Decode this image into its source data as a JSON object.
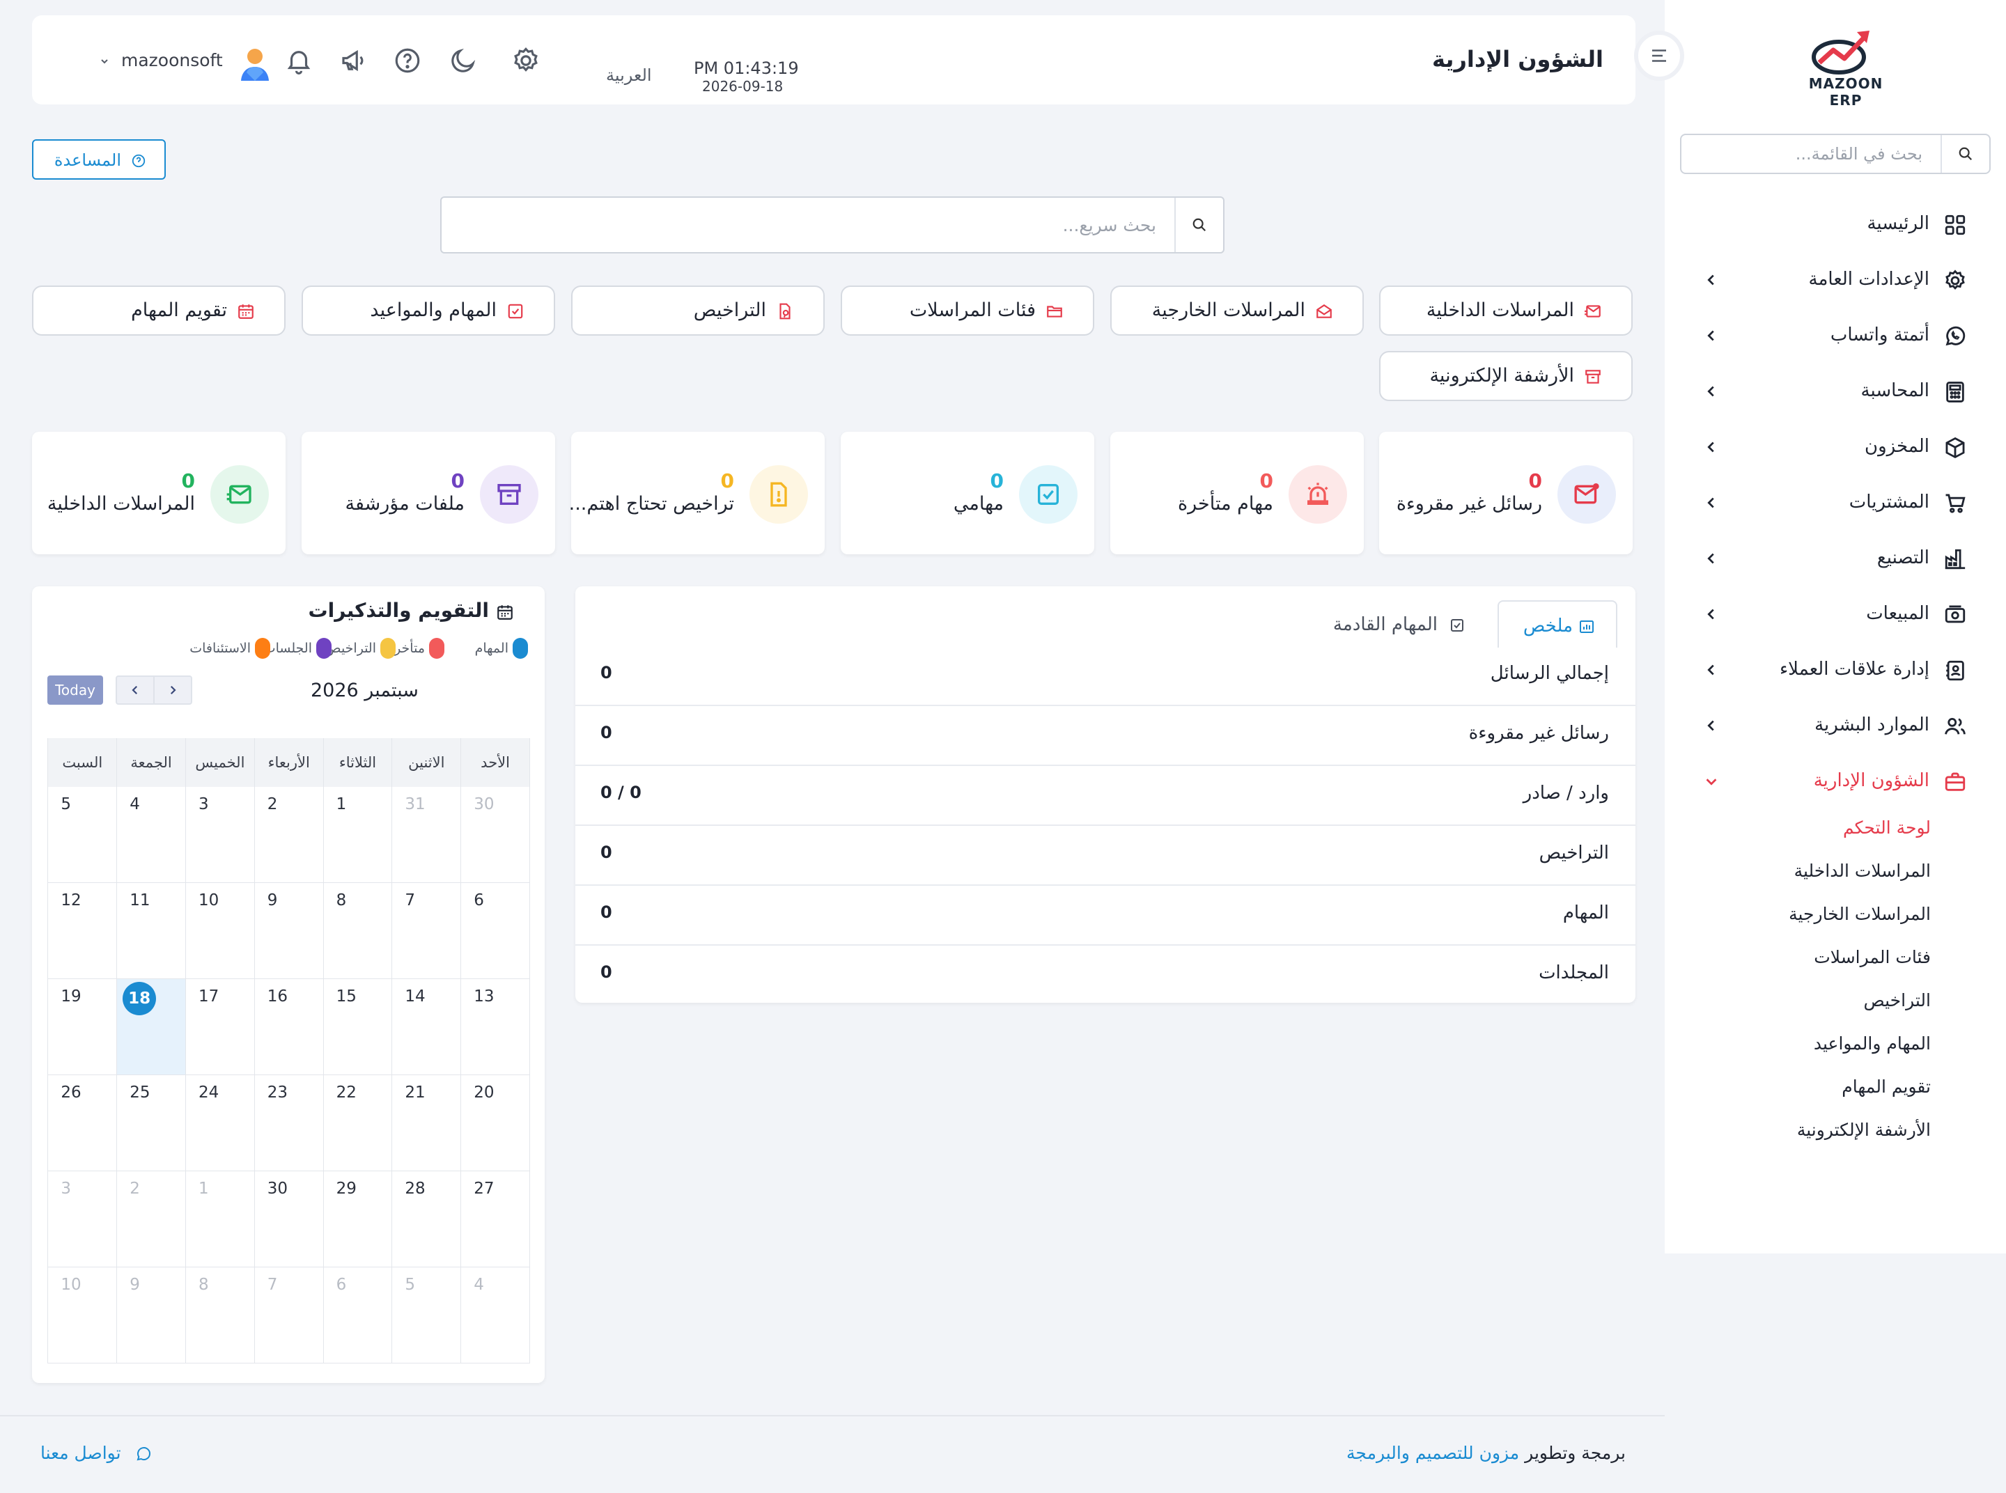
{
  "brand": {
    "logo_text": "MAZOON ERP"
  },
  "sidebar": {
    "search_placeholder": "بحث في القائمة...",
    "items": [
      {
        "label": "الرئيسية",
        "icon": "dashboard-grid-icon"
      },
      {
        "label": "الإعدادات العامة",
        "icon": "gear-icon"
      },
      {
        "label": "أتمتة واتساب",
        "icon": "whatsapp-icon"
      },
      {
        "label": "المحاسبة",
        "icon": "calculator-icon"
      },
      {
        "label": "المخزون",
        "icon": "package-icon"
      },
      {
        "label": "المشتريات",
        "icon": "cart-icon"
      },
      {
        "label": "التصنيع",
        "icon": "factory-icon"
      },
      {
        "label": "المبيعات",
        "icon": "cash-icon"
      },
      {
        "label": "إدارة علاقات العملاء",
        "icon": "contacts-icon"
      },
      {
        "label": "الموارد البشرية",
        "icon": "users-icon"
      },
      {
        "label": "الشؤون الإدارية",
        "icon": "briefcase-icon"
      }
    ],
    "sub_items": [
      "لوحة التحكم",
      "المراسلات الداخلية",
      "المراسلات الخارجية",
      "فئات المراسلات",
      "التراخيص",
      "المهام والمواعيد",
      "تقويم المهام",
      "الأرشفة الإلكترونية"
    ]
  },
  "header": {
    "title": "الشؤون الإدارية",
    "time": "PM 01:43:19",
    "date": "2026-09-18",
    "language": "العربية",
    "user": "mazoonsoft"
  },
  "help_button": "المساعدة",
  "quick_search_placeholder": "بحث سريع...",
  "shortcuts": [
    "المراسلات الداخلية",
    "المراسلات الخارجية",
    "فئات المراسلات",
    "التراخيص",
    "المهام والمواعيد",
    "تقويم المهام",
    "الأرشفة الإلكترونية"
  ],
  "stats": [
    {
      "value": "0",
      "title": "رسائل غير مقروءة",
      "color": "#e53b4b"
    },
    {
      "value": "0",
      "title": "مهام متأخرة",
      "color": "#f25a5a"
    },
    {
      "value": "0",
      "title": "مهامي",
      "color": "#27b3d8"
    },
    {
      "value": "0",
      "title": "تراخيص تحتاج اهتم...",
      "color": "#f5b623"
    },
    {
      "value": "0",
      "title": "ملفات مؤرشفة",
      "color": "#6f42c1"
    },
    {
      "value": "0",
      "title": "المراسلات الداخلية",
      "color": "#22b35e"
    }
  ],
  "summary": {
    "tabs": [
      "ملخص",
      "المهام القادمة"
    ],
    "rows": [
      {
        "label": "إجمالي الرسائل",
        "value": "0"
      },
      {
        "label": "رسائل غير مقروءة",
        "value": "0"
      },
      {
        "label": "وارد / صادر",
        "value": "0 / 0"
      },
      {
        "label": "التراخيص",
        "value": "0"
      },
      {
        "label": "المهام",
        "value": "0"
      },
      {
        "label": "المجلدات",
        "value": "0"
      }
    ]
  },
  "calendar": {
    "title": "التقويم والتذكيرات",
    "legend": [
      {
        "label": "المهام",
        "color": "#1a8bd1"
      },
      {
        "label": "متأخر",
        "color": "#f25a5a"
      },
      {
        "label": "التراخيص",
        "color": "#f5c542"
      },
      {
        "label": "الجلسات",
        "color": "#6f42c1"
      },
      {
        "label": "الاستئنافات",
        "color": "#fd7e14"
      }
    ],
    "today_label": "Today",
    "month": "سبتمبر 2026",
    "weekdays": [
      "الأحد",
      "الاثنين",
      "الثلاثاء",
      "الأربعاء",
      "الخميس",
      "الجمعة",
      "السبت"
    ],
    "weeks": [
      [
        "30",
        "31",
        "1",
        "2",
        "3",
        "4",
        "5"
      ],
      [
        "6",
        "7",
        "8",
        "9",
        "10",
        "11",
        "12"
      ],
      [
        "13",
        "14",
        "15",
        "16",
        "17",
        "18",
        "19"
      ],
      [
        "20",
        "21",
        "22",
        "23",
        "24",
        "25",
        "26"
      ],
      [
        "27",
        "28",
        "29",
        "30",
        "1",
        "2",
        "3"
      ],
      [
        "4",
        "5",
        "6",
        "7",
        "8",
        "9",
        "10"
      ]
    ],
    "today": "18"
  },
  "footer": {
    "credit_prefix": "برمجة وتطوير",
    "credit_link": "مزون للتصميم والبرمجة",
    "contact": "تواصل معنا"
  }
}
